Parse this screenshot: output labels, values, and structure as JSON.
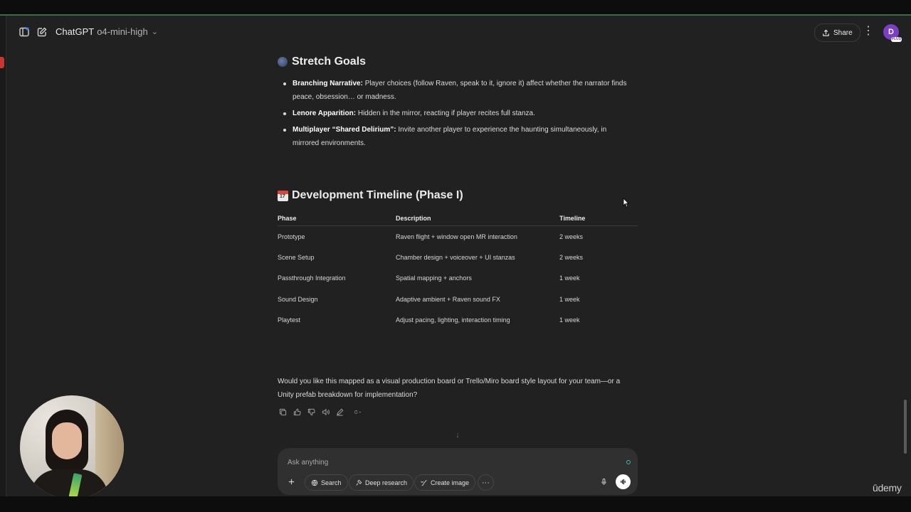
{
  "header": {
    "app_name": "ChatGPT",
    "model": "o4-mini-high",
    "share_label": "Share",
    "avatar_initial": "D",
    "avatar_badge": "PLUS"
  },
  "stretch_goals": {
    "title": "Stretch Goals",
    "items": [
      {
        "label": "Branching Narrative:",
        "text": " Player choices (follow Raven, speak to it, ignore it) affect whether the narrator finds peace, obsession… or madness."
      },
      {
        "label": "Lenore Apparition:",
        "text": " Hidden in the mirror, reacting if player recites full stanza."
      },
      {
        "label": "Multiplayer “Shared Delirium”:",
        "text": " Invite another player to experience the haunting simultaneously, in mirrored environments."
      }
    ]
  },
  "timeline": {
    "title": "Development Timeline (Phase I)",
    "headers": [
      "Phase",
      "Description",
      "Timeline"
    ],
    "rows": [
      [
        "Prototype",
        "Raven flight + window open MR interaction",
        "2 weeks"
      ],
      [
        "Scene Setup",
        "Chamber design + voiceover + UI stanzas",
        "2 weeks"
      ],
      [
        "Passthrough Integration",
        "Spatial mapping + anchors",
        "1 week"
      ],
      [
        "Sound Design",
        "Adaptive ambient + Raven sound FX",
        "1 week"
      ],
      [
        "Playtest",
        "Adjust pacing, lighting, interaction timing",
        "1 week"
      ]
    ]
  },
  "question": "Would you like this mapped as a visual production board or Trello/Miro board style layout for your team—or a Unity prefab breakdown for implementation?",
  "composer": {
    "placeholder": "Ask anything",
    "search_label": "Search",
    "deep_research_label": "Deep research",
    "create_image_label": "Create image"
  },
  "watermark": "ūdemy",
  "colors": {
    "background": "#212121",
    "composer": "#303030",
    "avatar": "#7b3fc4"
  }
}
